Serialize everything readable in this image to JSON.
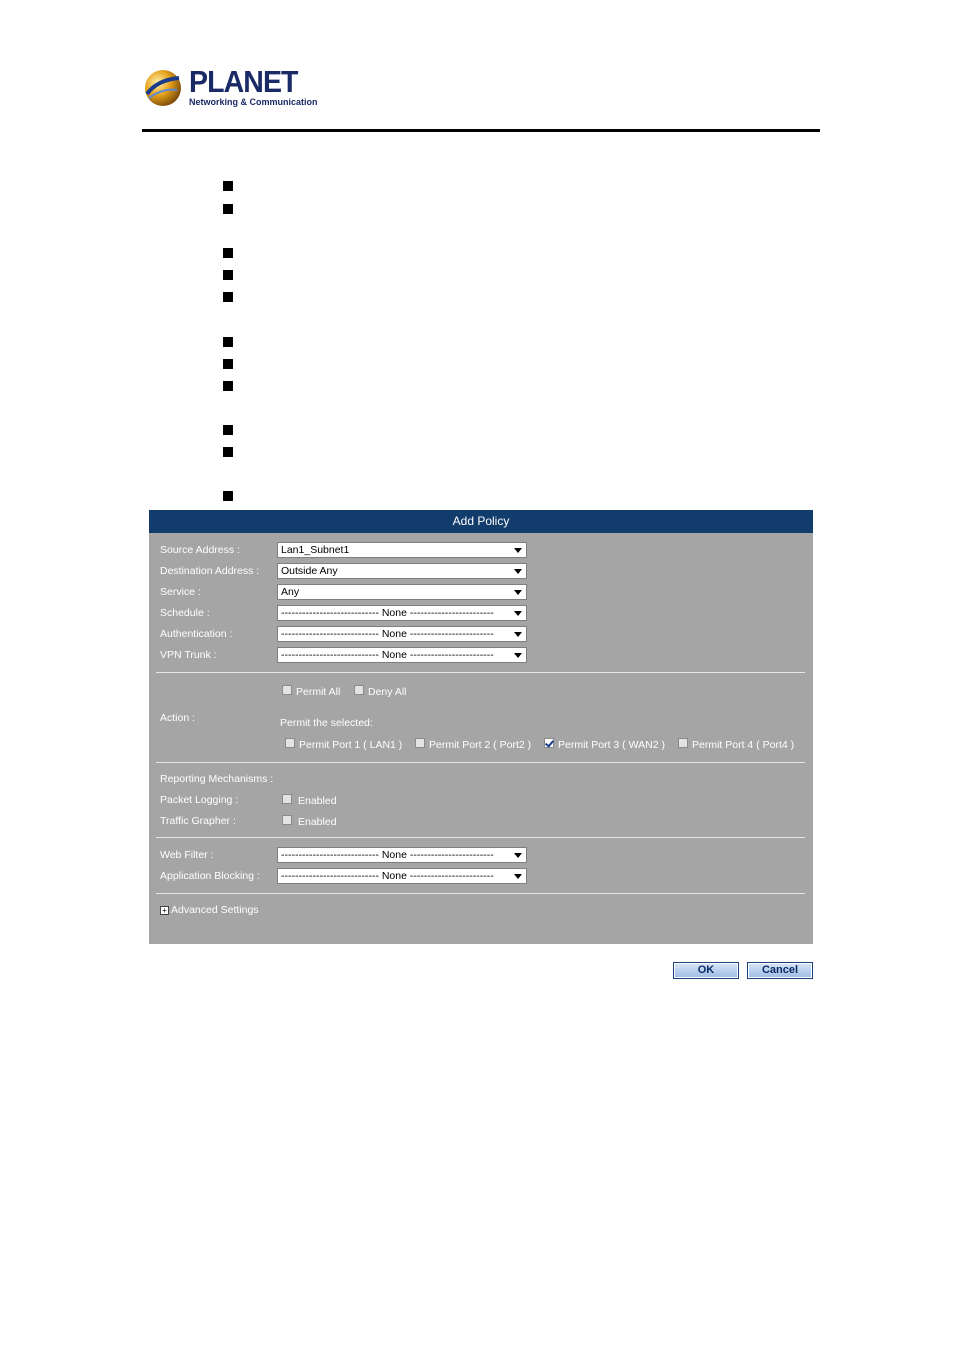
{
  "logo": {
    "brand": "PLANET",
    "tagline": "Networking & Communication"
  },
  "form": {
    "title": "Add Policy",
    "fields": [
      {
        "label": "Source Address :",
        "value": "Lan1_Subnet1"
      },
      {
        "label": "Destination Address :",
        "value": "Outside Any"
      },
      {
        "label": "Service :",
        "value": "Any"
      },
      {
        "label": "Schedule :",
        "value": "---------------------------- None ------------------------"
      },
      {
        "label": "Authentication :",
        "value": "---------------------------- None ------------------------"
      },
      {
        "label": "VPN Trunk :",
        "value": "---------------------------- None ------------------------"
      }
    ],
    "action": {
      "label": "Action :",
      "permit_all": "Permit All",
      "deny_all": "Deny All",
      "permit_selected": "Permit the selected:",
      "ports": [
        {
          "label": "Permit Port  1  ( LAN1 )",
          "checked": false
        },
        {
          "label": "Permit Port  2  ( Port2 )",
          "checked": false
        },
        {
          "label": "Permit Port  3  ( WAN2 )",
          "checked": true
        },
        {
          "label": "Permit Port  4  ( Port4 )",
          "checked": false
        }
      ]
    },
    "reporting": {
      "title": "Reporting Mechanisms :",
      "packet_logging": "Packet Logging :",
      "traffic_grapher": "Traffic Grapher :",
      "enabled": "Enabled"
    },
    "web_filter": {
      "label": "Web Filter :",
      "value": "---------------------------- None ------------------------"
    },
    "app_blocking": {
      "label": "Application Blocking :",
      "value": "---------------------------- None ------------------------"
    },
    "advanced": "Advanced Settings"
  },
  "buttons": {
    "ok": "OK",
    "cancel": "Cancel"
  },
  "colors": {
    "header": "#123c6b",
    "panel": "#a5a5a5"
  }
}
